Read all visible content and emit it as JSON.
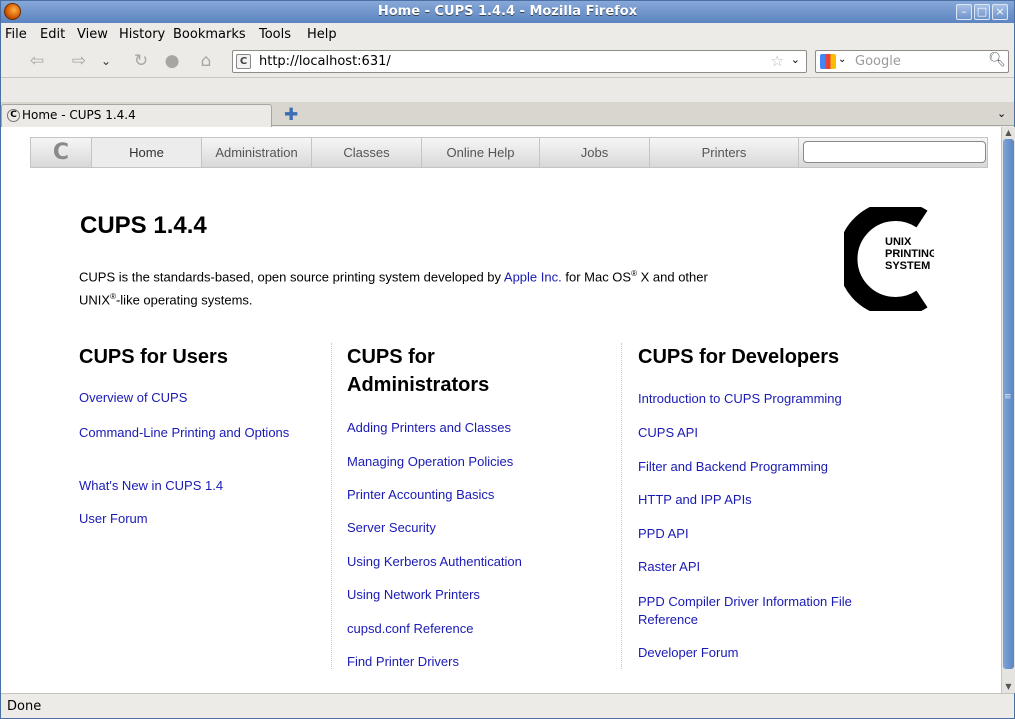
{
  "window": {
    "title": "Home - CUPS 1.4.4 - Mozilla Firefox"
  },
  "menu": [
    "File",
    "Edit",
    "View",
    "History",
    "Bookmarks",
    "Tools",
    "Help"
  ],
  "nav": {
    "url": "http://localhost:631/",
    "search_placeholder": "Google"
  },
  "tabs": [
    {
      "label": "Home - CUPS 1.4.4"
    }
  ],
  "cups_nav": {
    "tabs": [
      "Home",
      "Administration",
      "Classes",
      "Online Help",
      "Jobs",
      "Printers"
    ],
    "active": "Home"
  },
  "page": {
    "title": "CUPS 1.4.4",
    "intro_before_link": "CUPS is the standards-based, open source printing system developed by ",
    "intro_link": "Apple Inc.",
    "intro_mid": " for Mac OS",
    "intro_sup": "®",
    "intro_after": " X and other",
    "intro_line2_a": "UNIX",
    "intro_line2_sup": "®",
    "intro_line2_b": "-like operating systems.",
    "logo_lines": [
      "UNIX",
      "PRINTING",
      "SYSTEM"
    ]
  },
  "columns": {
    "users": {
      "heading": "CUPS for Users",
      "links": [
        "Overview of CUPS",
        "Command-Line Printing and Options",
        "What's New in CUPS 1.4",
        "User Forum"
      ]
    },
    "admins": {
      "heading_line1": "CUPS for",
      "heading_line2": "Administrators",
      "links": [
        "Adding Printers and Classes",
        "Managing Operation Policies",
        "Printer Accounting Basics",
        "Server Security",
        "Using Kerberos Authentication",
        "Using Network Printers",
        "cupsd.conf Reference",
        "Find Printer Drivers"
      ]
    },
    "developers": {
      "heading": "CUPS for Developers",
      "links": [
        "Introduction to CUPS Programming",
        "CUPS API",
        "Filter and Backend Programming",
        "HTTP and IPP APIs",
        "PPD API",
        "Raster API",
        "PPD Compiler Driver Information File Reference",
        "Developer Forum"
      ]
    }
  },
  "status": "Done",
  "colors": {
    "link": "#1a1ab5",
    "titlebar": "#5c84c0"
  }
}
